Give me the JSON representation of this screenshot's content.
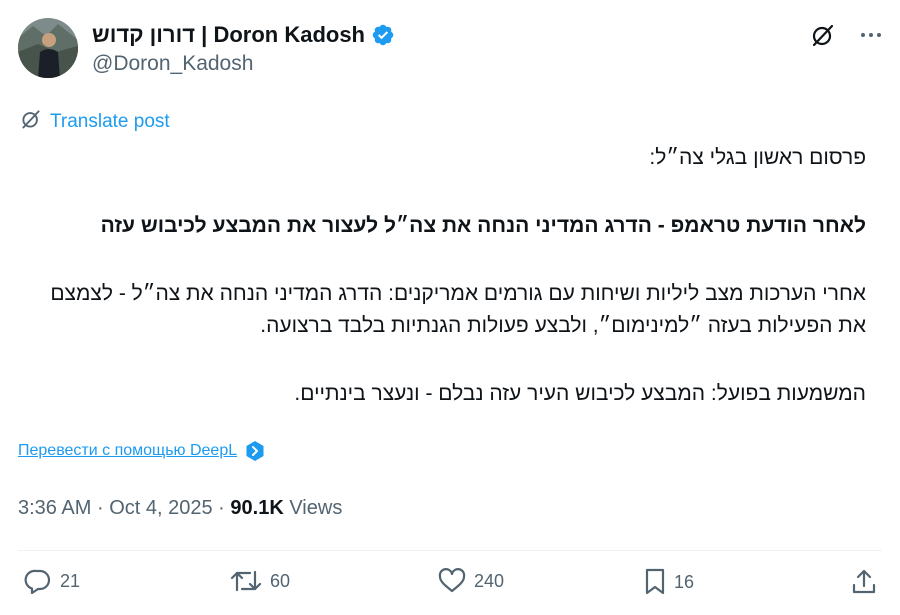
{
  "author": {
    "display_name": "דורון קדוש | Doron Kadosh",
    "handle": "@Doron_Kadosh"
  },
  "icons": {
    "avatar": "avatar-photo",
    "verified": "verified-badge-icon",
    "grok": "grok-icon",
    "more": "more-icon",
    "translate": "translate-icon",
    "deepl": "deepl-icon",
    "reply": "reply-icon",
    "repost": "repost-icon",
    "like": "like-icon",
    "bookmark": "bookmark-icon",
    "share": "share-icon"
  },
  "colors": {
    "accent": "#1d9bf0",
    "text": "#0f1419",
    "secondary": "#536471"
  },
  "translate_label": "Translate post",
  "post": {
    "line1": "פרסום ראשון בגלי צה״ל:",
    "line2": "לאחר הודעת טראמפ - הדרג המדיני הנחה את צה״ל לעצור את המבצע לכיבוש עזה",
    "line3": "אחרי הערכות מצב ליליות ושיחות עם גורמים אמריקנים: הדרג המדיני הנחה את צה״ל - לצמצם את הפעילות בעזה ״למינימום״, ולבצע פעולות הגנתיות בלבד ברצועה.",
    "line4": "המשמעות בפועל: המבצע לכיבוש העיר עזה נבלם - ונעצר בינתיים."
  },
  "deepl_label": "Перевести с помощью DeepL",
  "meta": {
    "time": "3:36 AM",
    "date": "Oct 4, 2025",
    "separator": "·",
    "views_count": "90.1K",
    "views_label": "Views"
  },
  "stats": {
    "replies": "21",
    "reposts": "60",
    "likes": "240",
    "bookmarks": "16"
  }
}
